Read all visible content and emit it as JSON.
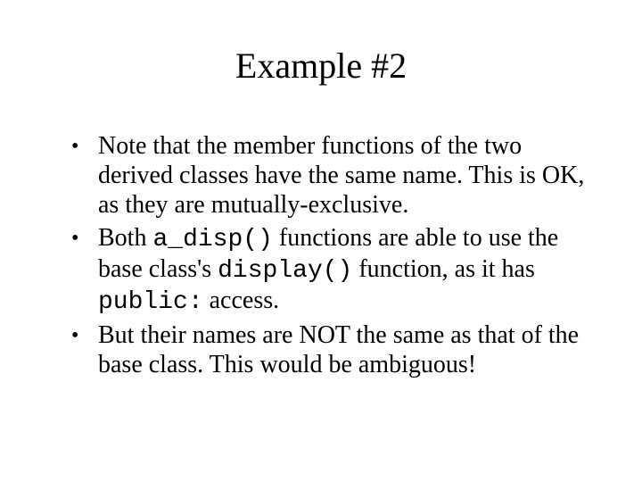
{
  "title": "Example #2",
  "bullets": [
    {
      "pre": "Note that the member functions of the two derived classes have the same name.  This is OK, as they are mutually-exclusive."
    },
    {
      "pre": "Both ",
      "code1": "a_disp()",
      "mid1": " functions are able to use the base class's ",
      "code2": "display()",
      "mid2": " function, as it has ",
      "code3": "public:",
      "post": " access."
    },
    {
      "pre": "But their names are NOT the same as that of the base class.  This would be ambiguous!"
    }
  ]
}
